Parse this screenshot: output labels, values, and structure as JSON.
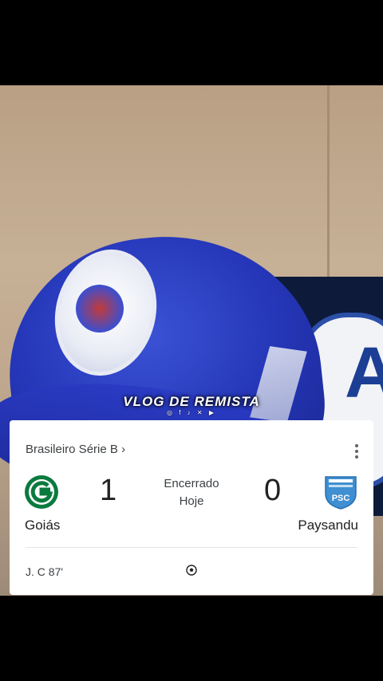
{
  "overlay": {
    "watermark": "VLOG DE REMISTA",
    "watermark_icons": "◎ f ♪ ✕ ▶"
  },
  "banner": {
    "letters": "AI"
  },
  "match_card": {
    "league": "Brasileiro Série B",
    "league_chevron": "›",
    "status": "Encerrado",
    "date": "Hoje",
    "home_team": {
      "name": "Goiás",
      "score": "1",
      "logo_letter": "G"
    },
    "away_team": {
      "name": "Paysandu",
      "score": "0",
      "logo_letters": "PSC"
    },
    "events": [
      {
        "player": "J. C 87'",
        "icon": "soccer-ball-icon"
      }
    ],
    "colors": {
      "goias_green": "#0b7a3e",
      "paysandu_blue": "#3f8fd2",
      "text_primary": "#202124",
      "text_secondary": "#3c4043"
    }
  }
}
